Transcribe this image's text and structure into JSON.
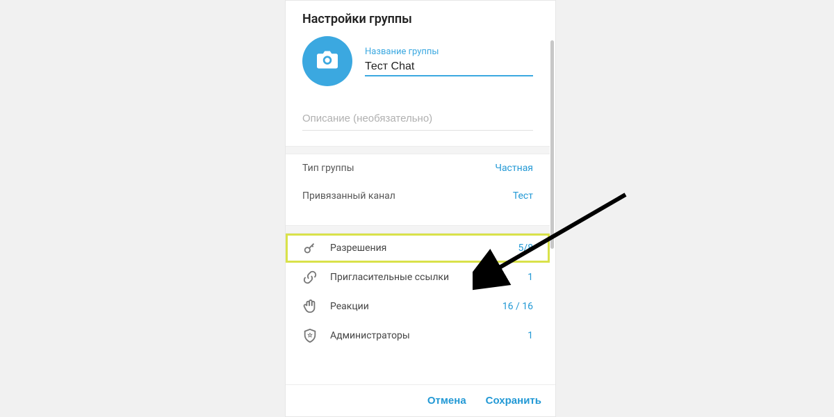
{
  "dialog": {
    "title": "Настройки группы",
    "group_name_label": "Название группы",
    "group_name_value": "Тест Chat",
    "description_placeholder": "Описание (необязательно)",
    "rows": {
      "group_type": {
        "label": "Тип группы",
        "value": "Частная"
      },
      "linked_channel": {
        "label": "Привязанный канал",
        "value": "Тест"
      }
    },
    "manage": {
      "permissions": {
        "label": "Разрешения",
        "value": "5/8"
      },
      "invite_links": {
        "label": "Пригласительные ссылки",
        "value": "1"
      },
      "reactions": {
        "label": "Реакции",
        "value": "16 / 16"
      },
      "admins": {
        "label": "Администраторы",
        "value": "1"
      }
    },
    "footer": {
      "cancel": "Отмена",
      "save": "Сохранить"
    }
  }
}
